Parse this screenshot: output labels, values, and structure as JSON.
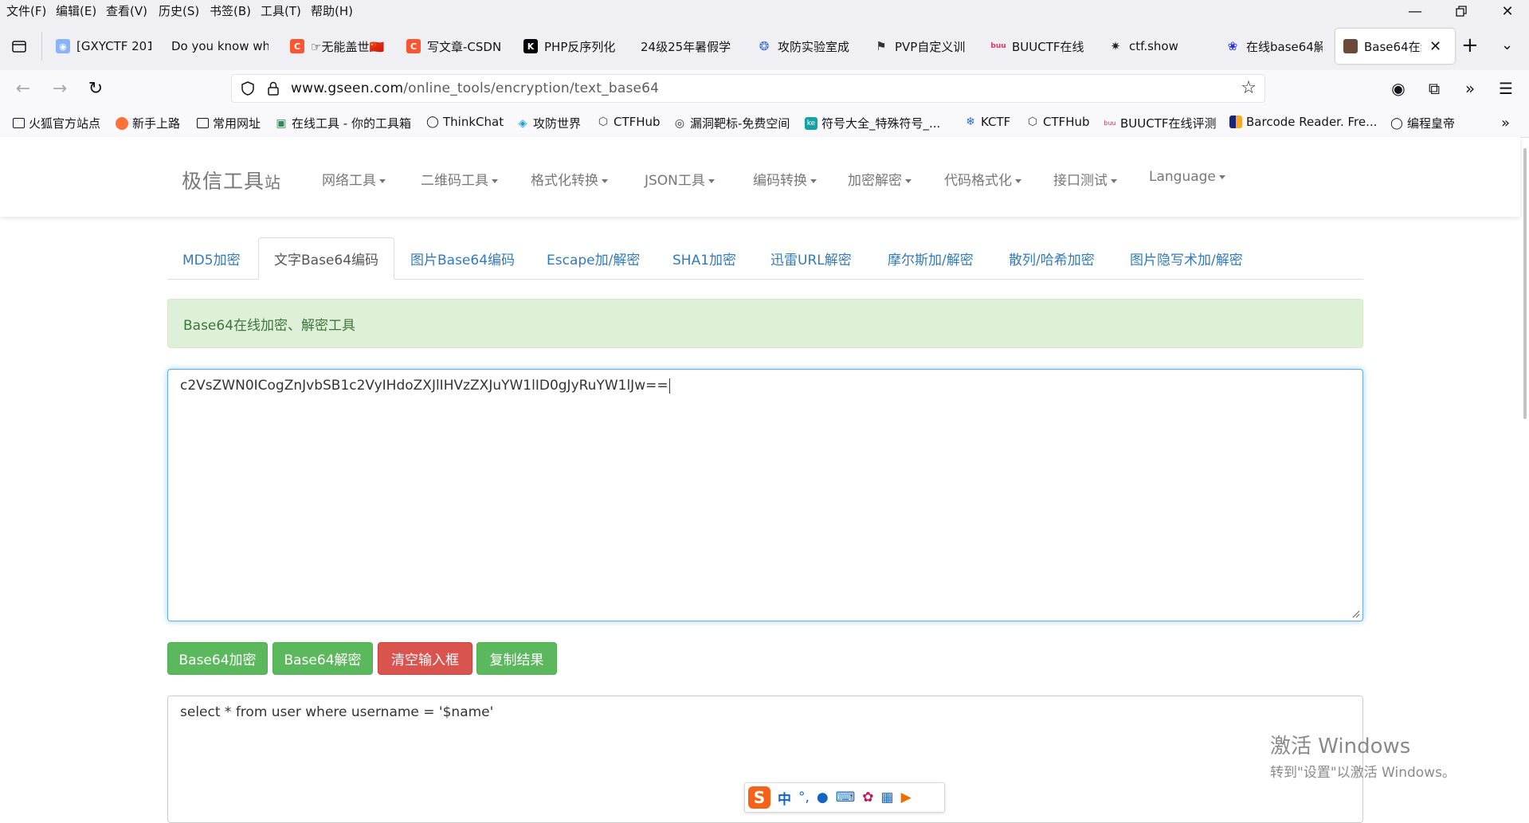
{
  "menubar": {
    "items": [
      "文件(F)",
      "编辑(E)",
      "查看(V)",
      "历史(S)",
      "书签(B)",
      "工具(T)",
      "帮助(H)"
    ]
  },
  "tabs": [
    {
      "title": "[GXYCTF 201",
      "icon": "globe-icon",
      "color": "#8ab4f8"
    },
    {
      "title": "Do you know wh",
      "icon": "none",
      "color": ""
    },
    {
      "title": "☞无能盖世🇨🇳",
      "icon": "csdn-icon",
      "color": "#fc5531"
    },
    {
      "title": "写文章-CSDN",
      "icon": "csdn-icon",
      "color": "#fc5531"
    },
    {
      "title": "PHP反序列化",
      "icon": "k-icon",
      "color": "#000000"
    },
    {
      "title": "24级25年暑假学",
      "icon": "none",
      "color": ""
    },
    {
      "title": "攻防实验室成",
      "icon": "bird-icon",
      "color": "#3b6fd8"
    },
    {
      "title": "PVP自定义训",
      "icon": "flag-icon",
      "color": "#333333"
    },
    {
      "title": "BUUCTF在线",
      "icon": "buu-icon",
      "color": "#e0345c"
    },
    {
      "title": "ctf.show",
      "icon": "runner-icon",
      "color": "#222222"
    },
    {
      "title": "在线base64解",
      "icon": "paw-icon",
      "color": "#2932e1"
    },
    {
      "title": "Base64在线",
      "icon": "avatar-icon",
      "color": "#6b4a3a"
    }
  ],
  "navbar": {
    "url_host": "www.gseen.com",
    "url_path": "/online_tools/encryption/text_base64"
  },
  "bookmarks": [
    {
      "label": "火狐官方站点",
      "icon": "folder-icon"
    },
    {
      "label": "新手上路",
      "icon": "firefox-icon"
    },
    {
      "label": "常用网址",
      "icon": "folder-icon"
    },
    {
      "label": "在线工具 - 你的工具箱",
      "icon": "tool-icon"
    },
    {
      "label": "ThinkChat",
      "icon": "globe-icon"
    },
    {
      "label": "攻防世界",
      "icon": "adworld-icon"
    },
    {
      "label": "CTFHub",
      "icon": "ctfhub-icon"
    },
    {
      "label": "漏洞靶标-免费空间",
      "icon": "target-icon"
    },
    {
      "label": "符号大全_特殊符号_...",
      "icon": "ke-icon"
    },
    {
      "label": "KCTF",
      "icon": "snowflake-icon"
    },
    {
      "label": "CTFHub",
      "icon": "ctfhub-icon"
    },
    {
      "label": "BUUCTF在线评测",
      "icon": "buu-icon"
    },
    {
      "label": "Barcode Reader. Fre...",
      "icon": "barcode-icon"
    },
    {
      "label": "编程皇帝",
      "icon": "globe-icon"
    }
  ],
  "site": {
    "brand_main": "极信工具",
    "brand_small": "站",
    "menu": [
      "网络工具",
      "二维码工具",
      "格式化转换",
      "JSON工具",
      "编码转换",
      "加密解密",
      "代码格式化",
      "接口测试",
      "Language"
    ],
    "subtabs": [
      "MD5加密",
      "文字Base64编码",
      "图片Base64编码",
      "Escape加/解密",
      "SHA1加密",
      "迅雷URL解密",
      "摩尔斯加/解密",
      "散列/哈希加密",
      "图片隐写术加/解密"
    ],
    "active_subtab": "文字Base64编码",
    "alert": "Base64在线加密、解密工具",
    "input_value": "c2VsZWN0ICogZnJvbSB1c2VyIHdoZXJlIHVzZXJuYW1lID0gJyRuYW1lJw==",
    "buttons": {
      "encode": "Base64加密",
      "decode": "Base64解密",
      "clear": "清空输入框",
      "copy": "复制结果"
    },
    "output_value": "select * from user where username = '$name'"
  },
  "watermark": {
    "line1": "激活 Windows",
    "line2": "转到\"设置\"以激活 Windows。"
  },
  "ime": {
    "logo": "S",
    "mode": "中",
    "punct": "°,"
  },
  "colors": {
    "success": "#5cb85c",
    "danger": "#d9534f",
    "link": "#337ab7",
    "alert_bg": "#dff0d8",
    "alert_text": "#3c763d"
  }
}
